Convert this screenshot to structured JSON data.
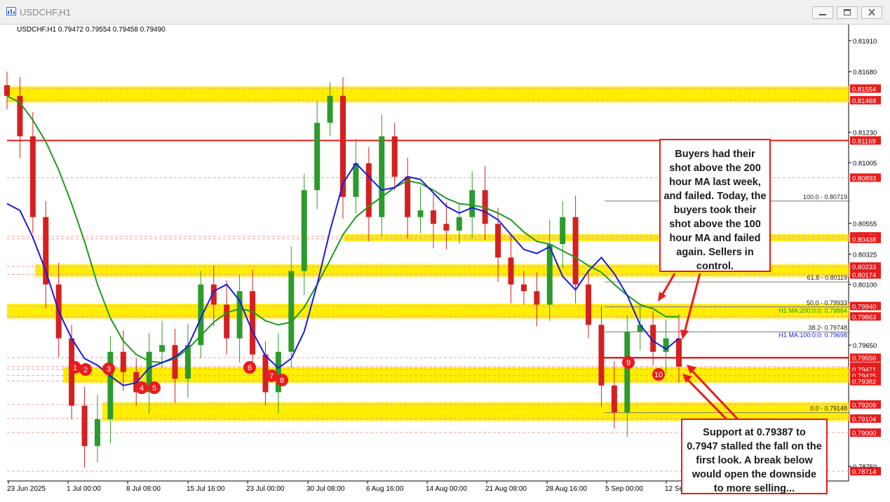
{
  "window": {
    "title": "USDCHF,H1"
  },
  "chart_info": "USDCHF,H1  0.79472 0.79554 0.79458 0.79490",
  "colors": {
    "zone": "#ffee00",
    "red": "#e81c1c",
    "ma100": "#1a1adc",
    "ma200": "#1f9a1f",
    "up": "#2d9a2d",
    "down": "#d42020"
  },
  "chart_data": {
    "type": "line",
    "symbol": "USDCHF",
    "timeframe": "H1",
    "ylim": [
      0.7864,
      0.82
    ],
    "x_tick_labels": [
      "23 Jun 2025",
      "1 Jul 00:00",
      "8 Jul 08:00",
      "15 Jul 16:00",
      "23 Jul 00:00",
      "30 Jul 08:00",
      "6 Aug 16:00",
      "14 Aug 00:00",
      "21 Aug 08:00",
      "28 Aug 16:00",
      "5 Sep 00:00",
      "12 Se"
    ],
    "y_tick_labels": [
      {
        "label": "0.81910",
        "v": 0.8191
      },
      {
        "label": "0.81680",
        "v": 0.8168
      },
      {
        "label": "0.81230",
        "v": 0.8123
      },
      {
        "label": "0.81005",
        "v": 0.81005
      },
      {
        "label": "0.80555",
        "v": 0.80555
      },
      {
        "label": "0.80325",
        "v": 0.80325
      },
      {
        "label": "0.80100",
        "v": 0.801
      },
      {
        "label": "0.79650",
        "v": 0.7965
      },
      {
        "label": "0.78750",
        "v": 0.7875
      }
    ],
    "price_tags": [
      {
        "label": "0.81554",
        "v": 0.81554
      },
      {
        "label": "0.81468",
        "v": 0.81468
      },
      {
        "label": "0.81169",
        "v": 0.81169
      },
      {
        "label": "0.80893",
        "v": 0.80893
      },
      {
        "label": "0.80457",
        "v": 0.80457
      },
      {
        "label": "0.80438",
        "v": 0.80438
      },
      {
        "label": "0.80233",
        "v": 0.80233
      },
      {
        "label": "0.80174",
        "v": 0.80174
      },
      {
        "label": "0.79940",
        "v": 0.7994
      },
      {
        "label": "0.79863",
        "v": 0.79863
      },
      {
        "label": "0.79556",
        "v": 0.79556
      },
      {
        "label": "0.79490",
        "v": 0.7949
      },
      {
        "label": "0.79471",
        "v": 0.79471
      },
      {
        "label": "0.79425",
        "v": 0.79425
      },
      {
        "label": "0.79382",
        "v": 0.79382
      },
      {
        "label": "0.79209",
        "v": 0.79209
      },
      {
        "label": "0.79104",
        "v": 0.79104
      },
      {
        "label": "0.79000",
        "v": 0.79
      },
      {
        "label": "0.78714",
        "v": 0.78714
      }
    ],
    "zones": [
      [
        0.81468,
        0.81554
      ],
      [
        0.80438,
        0.80457
      ],
      [
        0.80174,
        0.80233
      ],
      [
        0.79863,
        0.7994
      ],
      [
        0.79387,
        0.7947
      ],
      [
        0.79104,
        0.79209
      ]
    ],
    "fib_levels": [
      {
        "label": "100.0 - 0.80719",
        "v": 0.80719
      },
      {
        "label": "61.8 - 0.80119",
        "v": 0.80119
      },
      {
        "label": "50.0 - 0.79933",
        "v": 0.79933
      },
      {
        "label": "38.2- 0.79748",
        "v": 0.79748
      },
      {
        "label": "0.0 - 0.79148",
        "v": 0.79148
      }
    ],
    "ma_labels": {
      "ma200": "H1 MA:200:0:0: 0.79864",
      "ma100": "H1 MA:100:0:0: 0.79698"
    },
    "series": [
      {
        "name": "H1 MA:100",
        "values": [
          0.807,
          0.8065,
          0.8045,
          0.802,
          0.799,
          0.797,
          0.7955,
          0.795,
          0.7942,
          0.7935,
          0.7937,
          0.7948,
          0.7952,
          0.7956,
          0.7964,
          0.7985,
          0.8005,
          0.801,
          0.7998,
          0.7975,
          0.7957,
          0.7948,
          0.7955,
          0.7975,
          0.801,
          0.805,
          0.8085,
          0.81,
          0.809,
          0.808,
          0.8082,
          0.809,
          0.8088,
          0.8078,
          0.8068,
          0.8063,
          0.8067,
          0.8064,
          0.8058,
          0.8047,
          0.8036,
          0.8033,
          0.8038,
          0.8016,
          0.8006,
          0.802,
          0.803,
          0.8018,
          0.8002,
          0.798,
          0.7968,
          0.7962,
          0.797
        ]
      },
      {
        "name": "H1 MA:200",
        "values": [
          0.815,
          0.8145,
          0.8132,
          0.8116,
          0.8095,
          0.807,
          0.8042,
          0.801,
          0.7985,
          0.7968,
          0.7958,
          0.7953,
          0.7952,
          0.7955,
          0.7962,
          0.7972,
          0.7982,
          0.7989,
          0.7992,
          0.799,
          0.7983,
          0.798,
          0.7982,
          0.7993,
          0.801,
          0.8028,
          0.8047,
          0.806,
          0.8068,
          0.8075,
          0.8082,
          0.8087,
          0.8085,
          0.808,
          0.8074,
          0.807,
          0.8069,
          0.8067,
          0.8063,
          0.8058,
          0.8049,
          0.8042,
          0.804,
          0.8035,
          0.803,
          0.8024,
          0.8019,
          0.801,
          0.8002,
          0.7995,
          0.7992,
          0.7986,
          0.7986
        ]
      },
      {
        "name": "USDCHF",
        "values": [
          0.815,
          0.812,
          0.806,
          0.801,
          0.797,
          0.792,
          0.789,
          0.791,
          0.796,
          0.7945,
          0.793,
          0.796,
          0.7965,
          0.794,
          0.7965,
          0.801,
          0.7995,
          0.797,
          0.8005,
          0.7958,
          0.793,
          0.796,
          0.802,
          0.808,
          0.813,
          0.815,
          0.8075,
          0.81,
          0.806,
          0.812,
          0.809,
          0.806,
          0.8065,
          0.8055,
          0.805,
          0.806,
          0.808,
          0.8055,
          0.803,
          0.801,
          0.8005,
          0.7995,
          0.804,
          0.806,
          0.801,
          0.798,
          0.7935,
          0.7915,
          0.7975,
          0.798,
          0.796,
          0.797,
          0.7949
        ]
      }
    ],
    "markers": [
      "1",
      "2",
      "3",
      "4",
      "5",
      "6",
      "7",
      "8",
      "9",
      "10"
    ]
  },
  "annotations": {
    "buyers": "Buyers had their shot above the 200 hour MA last week, and failed. Today, the buyers took their shot above the 100 hour MA and failed again. Sellers in control.",
    "support": "Support at 0.79387 to 0.7947 stalled the fall on the first look.  A break below would open the downside to more selling..."
  }
}
